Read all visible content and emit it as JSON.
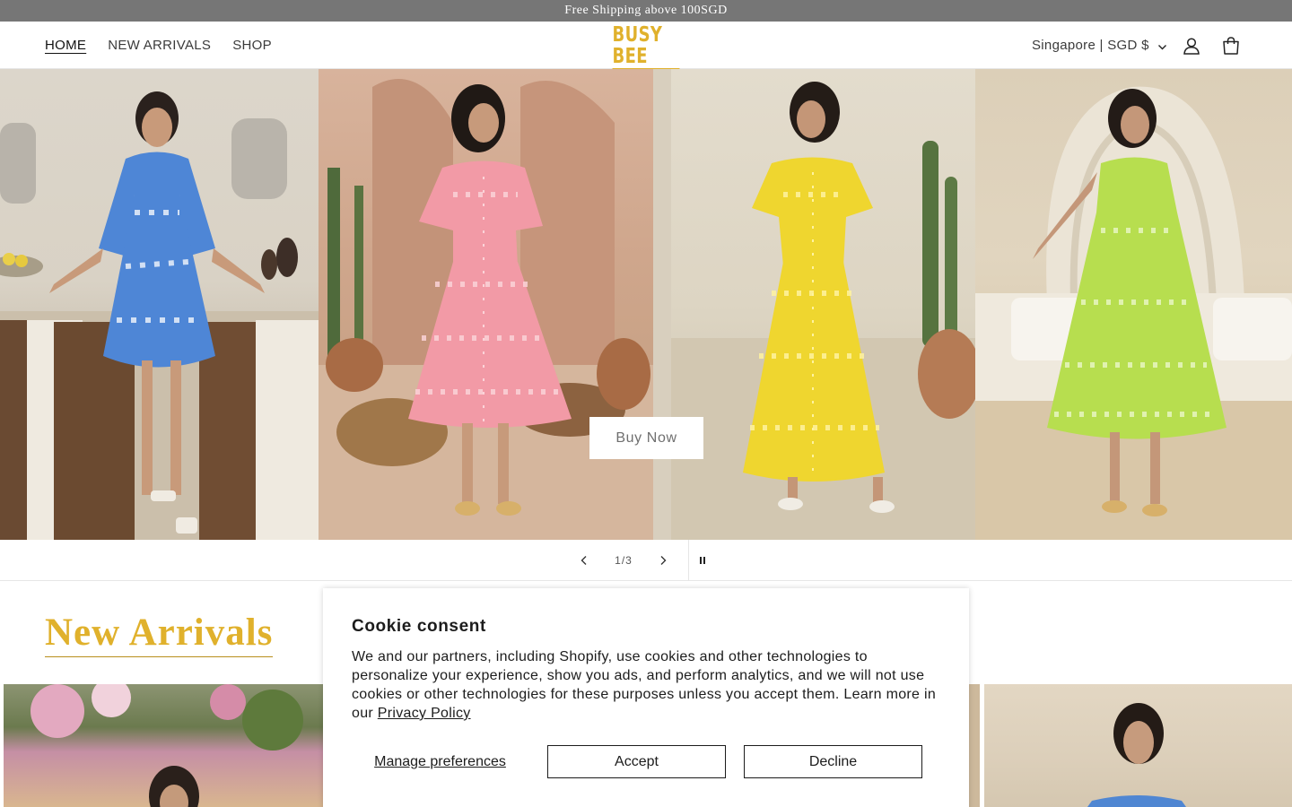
{
  "announcement": {
    "text": "Free Shipping above 100SGD"
  },
  "header": {
    "nav": [
      {
        "label": "HOME"
      },
      {
        "label": "NEW ARRIVALS"
      },
      {
        "label": "SHOP"
      }
    ],
    "logo_text": "BUSY BEE",
    "locale_label": "Singapore | SGD $",
    "icons": {
      "account": "user-icon",
      "cart": "bag-icon",
      "locale": "chevron-down-icon"
    }
  },
  "hero": {
    "cta_label": "Buy Now",
    "slides": [
      {
        "dress_color": "#4e86d6",
        "alt_color": "#ffffff"
      },
      {
        "dress_color": "#f29aa6",
        "alt_color": "#fbd3d8"
      },
      {
        "dress_color": "#efd62f",
        "alt_color": "#fff3a0"
      },
      {
        "dress_color": "#b7de4f",
        "alt_color": "#e8f6c1"
      }
    ]
  },
  "slider": {
    "counter": "1/3",
    "icons": {
      "prev": "chevron-left-icon",
      "next": "chevron-right-icon",
      "pause": "pause-icon"
    }
  },
  "new_arrivals": {
    "title": "New Arrivals"
  },
  "cookie": {
    "title": "Cookie consent",
    "body": "We and our partners, including Shopify, use cookies and other technologies to personalize your experience, show you ads, and perform analytics, and we will not use cookies or other technologies for these purposes unless you accept them. Learn more in our",
    "link_label": "Privacy Policy",
    "manage_label": "Manage preferences",
    "accept_label": "Accept",
    "decline_label": "Decline"
  },
  "colors": {
    "brand": "#e0b12c",
    "announcement_bg": "#767676"
  }
}
